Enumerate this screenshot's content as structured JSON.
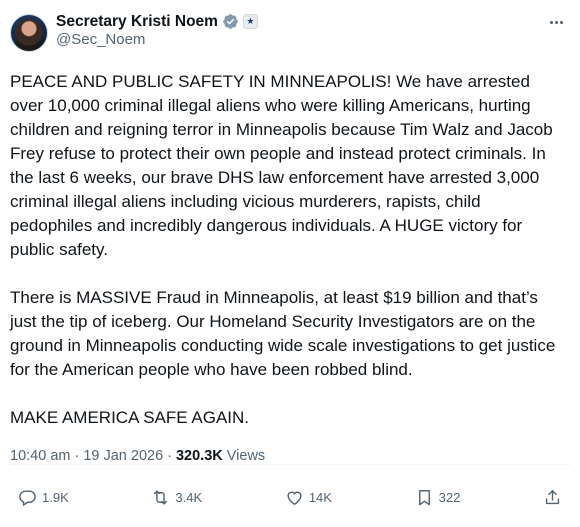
{
  "author": {
    "name": "Secretary Kristi Noem",
    "handle": "@Sec_Noem",
    "verified_icon": "verified-badge-icon",
    "affiliation_icon": "dhs-seal-icon"
  },
  "tweet": {
    "paragraphs": [
      "PEACE AND PUBLIC SAFETY IN MINNEAPOLIS! We have arrested over 10,000 criminal illegal aliens who were killing Americans, hurting children and reigning terror in Minneapolis because Tim Walz and Jacob Frey refuse to protect their own people and instead protect criminals. In the last 6 weeks, our brave DHS law enforcement have arrested 3,000 criminal illegal aliens including vicious murderers, rapists, child pedophiles and incredibly dangerous individuals. A HUGE victory for public safety.",
      "There is MASSIVE Fraud in Minneapolis, at least $19 billion and that’s just the tip of iceberg. Our Homeland Security Investigators are on the ground in Minneapolis conducting wide scale investigations to get justice for the American people who have been robbed blind.",
      "MAKE AMERICA SAFE AGAIN."
    ],
    "time": "10:40 am",
    "date": "19 Jan 2026",
    "separator": "·",
    "views_count": "320.3K",
    "views_label": "Views"
  },
  "actions": {
    "replies": "1.9K",
    "reposts": "3.4K",
    "likes": "14K",
    "bookmarks": "322"
  },
  "colors": {
    "text": "#0f1419",
    "muted": "#536471",
    "verified": "#829aab"
  }
}
